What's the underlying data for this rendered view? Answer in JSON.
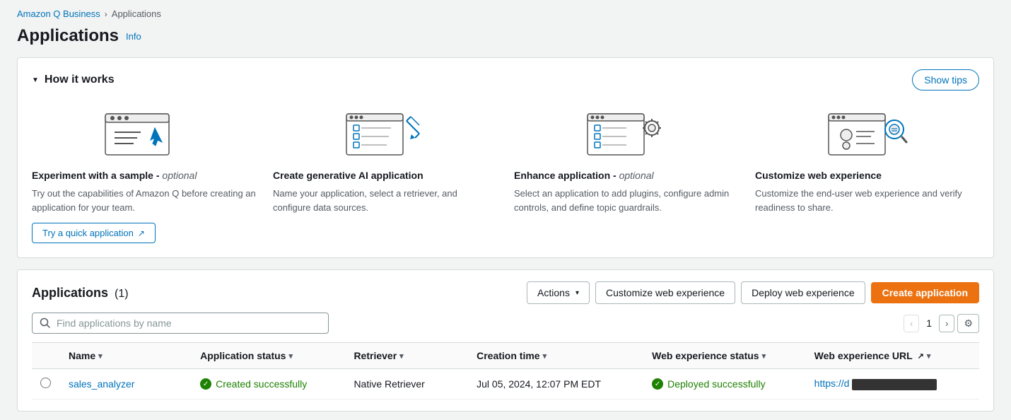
{
  "breadcrumb": {
    "parent": "Amazon Q Business",
    "current": "Applications"
  },
  "page": {
    "title": "Applications",
    "info_label": "Info"
  },
  "how_it_works": {
    "title": "How it works",
    "show_tips_label": "Show tips",
    "steps": [
      {
        "id": "step1",
        "title": "Experiment with a sample",
        "optional": true,
        "description": "Try out the capabilities of Amazon Q before creating an application for your team.",
        "cta_label": "Try a quick application",
        "has_cta": true
      },
      {
        "id": "step2",
        "title": "Create generative AI application",
        "optional": false,
        "description": "Name your application, select a retriever, and configure data sources.",
        "has_cta": false
      },
      {
        "id": "step3",
        "title": "Enhance application",
        "optional": true,
        "description": "Select an application to add plugins, configure admin controls, and define topic guardrails.",
        "has_cta": false
      },
      {
        "id": "step4",
        "title": "Customize web experience",
        "optional": false,
        "description": "Customize the end-user web experience and verify readiness to share.",
        "has_cta": false
      }
    ]
  },
  "applications_section": {
    "title": "Applications",
    "count": 1,
    "count_label": "(1)",
    "search_placeholder": "Find applications by name",
    "actions_label": "Actions",
    "customize_web_label": "Customize web experience",
    "deploy_web_label": "Deploy web experience",
    "create_app_label": "Create application",
    "page_number": "1",
    "table": {
      "columns": [
        {
          "id": "name",
          "label": "Name",
          "sortable": true
        },
        {
          "id": "status",
          "label": "Application status",
          "sortable": true
        },
        {
          "id": "retriever",
          "label": "Retriever",
          "sortable": true
        },
        {
          "id": "creation_time",
          "label": "Creation time",
          "sortable": true
        },
        {
          "id": "web_status",
          "label": "Web experience status",
          "sortable": true
        },
        {
          "id": "web_url",
          "label": "Web experience URL",
          "sortable": true
        }
      ],
      "rows": [
        {
          "id": "row1",
          "name": "sales_analyzer",
          "status": "Created successfully",
          "retriever": "Native Retriever",
          "creation_time": "Jul 05, 2024, 12:07 PM EDT",
          "web_status": "Deployed successfully",
          "web_url": "https://d"
        }
      ]
    }
  }
}
